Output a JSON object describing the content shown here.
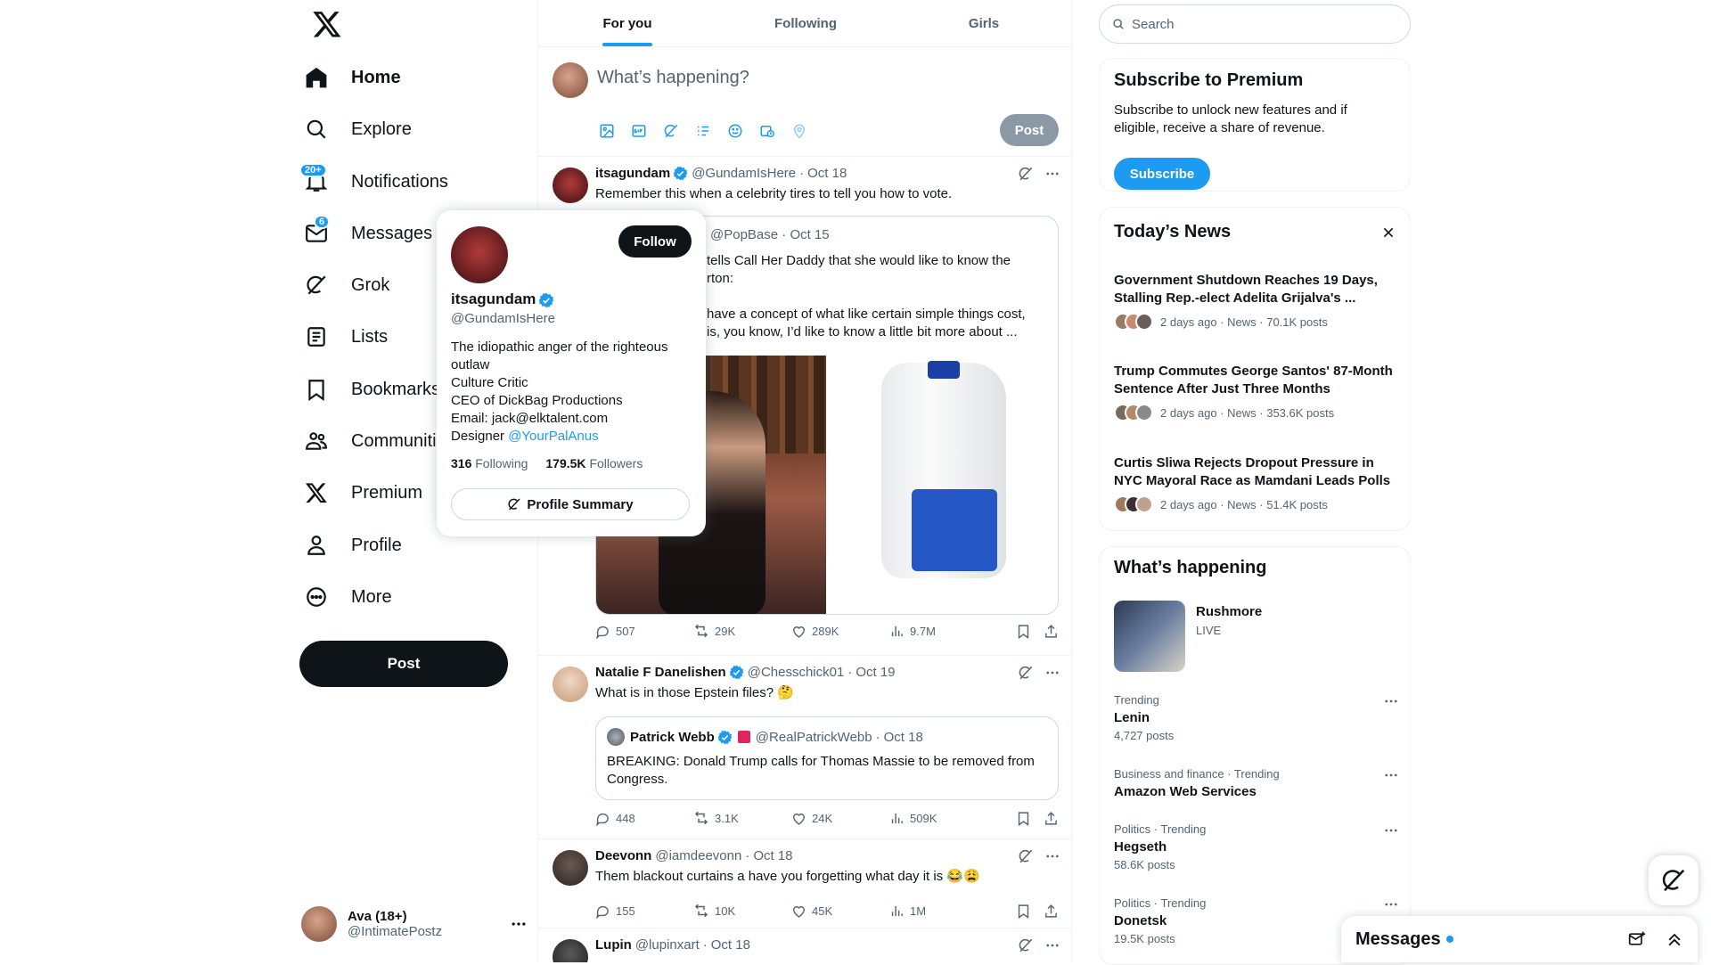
{
  "nav": {
    "items": [
      {
        "label": "Home",
        "icon": "home-icon"
      },
      {
        "label": "Explore",
        "icon": "search-icon"
      },
      {
        "label": "Notifications",
        "icon": "bell-icon",
        "badge": "20+"
      },
      {
        "label": "Messages",
        "icon": "mail-icon",
        "badge": "6"
      },
      {
        "label": "Grok",
        "icon": "grok-icon"
      },
      {
        "label": "Lists",
        "icon": "list-icon"
      },
      {
        "label": "Bookmarks",
        "icon": "bookmark-icon"
      },
      {
        "label": "Communities",
        "icon": "communities-icon"
      },
      {
        "label": "Premium",
        "icon": "x-logo-icon"
      },
      {
        "label": "Profile",
        "icon": "user-icon"
      },
      {
        "label": "More",
        "icon": "more-circle-icon"
      }
    ],
    "post_label": "Post",
    "account": {
      "name": "Ava (18+)",
      "handle": "@IntimatePostz"
    }
  },
  "tabs": [
    {
      "label": "For you",
      "active": true
    },
    {
      "label": "Following",
      "active": false
    },
    {
      "label": "Girls",
      "active": false
    }
  ],
  "composer": {
    "placeholder": "What’s happening?",
    "post_label": "Post"
  },
  "tweets": [
    {
      "name": "itsagundam",
      "handle": "@GundamIsHere",
      "date": "Oct 18",
      "text": "Remember this when a celebrity tires to tell you how to vote.",
      "quote": {
        "handle": "@PopBase",
        "date": "Oct 15",
        "line1": "tells Call Her Daddy that she would like to know the",
        "line2": "rton:",
        "line3": "have a concept of what like certain simple things cost,",
        "line4": "is, you know, I’d like to know a little bit more about ..."
      },
      "replies": "507",
      "reposts": "29K",
      "likes": "289K",
      "views": "9.7M"
    },
    {
      "name": "Natalie F Danelishen",
      "handle": "@Chesschick01",
      "date": "Oct 19",
      "text": "What is in those Epstein files? 🤔",
      "quote": {
        "name": "Patrick Webb",
        "handle": "@RealPatrickWebb",
        "date": "Oct 18",
        "text": "BREAKING: Donald Trump calls for Thomas Massie to be removed from Congress."
      },
      "replies": "448",
      "reposts": "3.1K",
      "likes": "24K",
      "views": "509K"
    },
    {
      "name": "Deevonn",
      "handle": "@iamdeevonn",
      "date": "Oct 18",
      "text": "Them blackout curtains a have you forgetting what day it is 😂😩",
      "replies": "155",
      "reposts": "10K",
      "likes": "45K",
      "views": "1M"
    },
    {
      "name": "Lupin",
      "handle": "@lupinxart",
      "date": "Oct 18"
    }
  ],
  "hovercard": {
    "name": "itsagundam",
    "handle": "@GundamIsHere",
    "follow_label": "Follow",
    "bio": [
      "The idiopathic anger of the righteous outlaw",
      "Culture Critic",
      "CEO of DickBag Productions",
      "Email:  jack@elktalent.com"
    ],
    "bio_designer": "Designer ",
    "bio_link": "@YourPalAnus",
    "following": "316",
    "following_label": "Following",
    "followers": "179.5K",
    "followers_label": "Followers",
    "summary_label": "Profile Summary"
  },
  "search": {
    "placeholder": "Search"
  },
  "premium": {
    "title": "Subscribe to Premium",
    "text": "Subscribe to unlock new features and if eligible, receive a share of revenue.",
    "button": "Subscribe"
  },
  "news": {
    "title": "Today’s News",
    "items": [
      {
        "title": "Government Shutdown Reaches 19 Days, Stalling Rep.-elect Adelita Grijalva's ...",
        "meta": "2 days ago · News · 70.1K posts"
      },
      {
        "title": "Trump Commutes George Santos' 87-Month Sentence After Just Three Months",
        "meta": "2 days ago · News · 353.6K posts"
      },
      {
        "title": "Curtis Sliwa Rejects Dropout Pressure in NYC Mayoral Race as Mamdani Leads Polls",
        "meta": "2 days ago · News · 51.4K posts"
      }
    ]
  },
  "happening": {
    "title": "What’s happening",
    "live": {
      "name": "Rushmore",
      "status": "LIVE"
    },
    "trends": [
      {
        "category": "Trending",
        "name": "Lenin",
        "posts": "4,727 posts"
      },
      {
        "category": "Business and finance · Trending",
        "name": "Amazon Web Services",
        "posts": ""
      },
      {
        "category": "Politics · Trending",
        "name": "Hegseth",
        "posts": "58.6K posts"
      },
      {
        "category": "Politics · Trending",
        "name": "Donetsk",
        "posts": "19.5K posts"
      }
    ]
  },
  "messages_dock": {
    "label": "Messages"
  },
  "colors": {
    "accent": "#1d9bf0",
    "text": "#0f1419",
    "muted": "#536471",
    "border": "#eff3f4"
  }
}
